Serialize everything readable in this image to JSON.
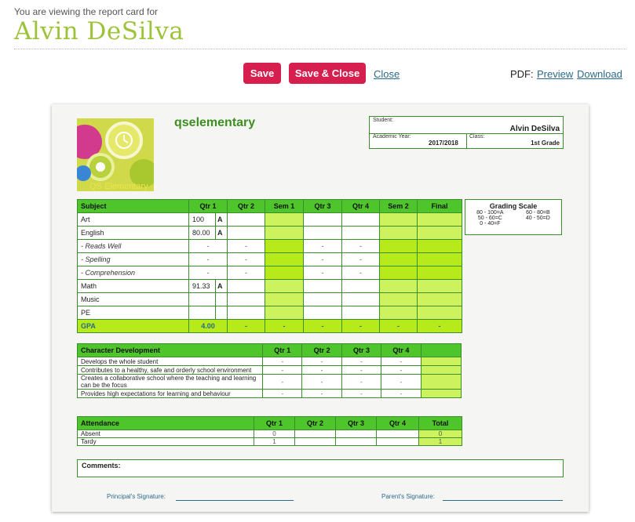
{
  "intro_text": "You are viewing the report card for",
  "student_name": "Alvin DeSilva",
  "toolbar": {
    "save_label": "Save",
    "save_close_label": "Save & Close",
    "close_label": "Close",
    "pdf_label": "PDF:",
    "preview_label": "Preview",
    "download_label": "Download"
  },
  "colors": {
    "brand_green": "#9dc33b",
    "button_red": "#d61f4e",
    "header_green": "#4ec52a",
    "cell_green": "#ccf25e",
    "link_blue": "#2a6a8a"
  },
  "report": {
    "school_name": "qselementary",
    "logo_text": "QS Elementary",
    "student_label": "Student:",
    "student_value": "Alvin DeSilva",
    "year_label": "Academic Year:",
    "year_value": "2017/2018",
    "class_label": "Class:",
    "class_value": "1st Grade",
    "grades": {
      "headers": [
        "Subject",
        "Qtr 1",
        "Qtr 2",
        "Sem 1",
        "Qtr 3",
        "Qtr 4",
        "Sem 2",
        "Final"
      ],
      "rows": [
        {
          "subject": "Art",
          "q1": "100",
          "q1_letter": "A",
          "sub": false
        },
        {
          "subject": "English",
          "q1": "80.00",
          "q1_letter": "A",
          "sub": false
        },
        {
          "subject": "-    Reads Well",
          "q1": "-",
          "q2": "-",
          "q3": "-",
          "q4": "-",
          "sub": true
        },
        {
          "subject": "-    Spelling",
          "q1": "-",
          "q2": "-",
          "q3": "-",
          "q4": "-",
          "sub": true
        },
        {
          "subject": "-    Comprehension",
          "q1": "-",
          "q2": "-",
          "q3": "-",
          "q4": "-",
          "sub": true
        },
        {
          "subject": "Math",
          "q1": "91.33",
          "q1_letter": "A",
          "sub": false
        },
        {
          "subject": "Music",
          "sub": false
        },
        {
          "subject": "PE",
          "sub": false
        }
      ],
      "gpa_label": "GPA",
      "gpa_values": [
        "4.00",
        "-",
        "-",
        "-",
        "-",
        "-",
        "-"
      ]
    },
    "grading_scale": {
      "title": "Grading Scale",
      "left": [
        "80 - 100=A",
        "50 - 60=C",
        "0 - 40=F"
      ],
      "right": [
        "60 - 80=B",
        "40 - 50=D"
      ]
    },
    "character": {
      "headers": [
        "Character Development",
        "Qtr 1",
        "Qtr 2",
        "Qtr 3",
        "Qtr 4"
      ],
      "rows": [
        "Develops the whole student",
        "Contributes to a healthy, safe and orderly school environment",
        "Creates a collaborative school where the teaching and learning can be the focus",
        "Provides high expectations for learning and behaviour"
      ],
      "cell": "-"
    },
    "attendance": {
      "headers": [
        "Attendance",
        "Qtr 1",
        "Qtr 2",
        "Qtr 3",
        "Qtr 4",
        "Total"
      ],
      "rows": [
        {
          "label": "Absent",
          "q1": "0",
          "total": "0"
        },
        {
          "label": "Tardy",
          "q1": "1",
          "total": "1"
        }
      ]
    },
    "comments_label": "Comments:",
    "principal_sig_label": "Principal's Signature:",
    "parent_sig_label": "Parent's Signature:"
  }
}
